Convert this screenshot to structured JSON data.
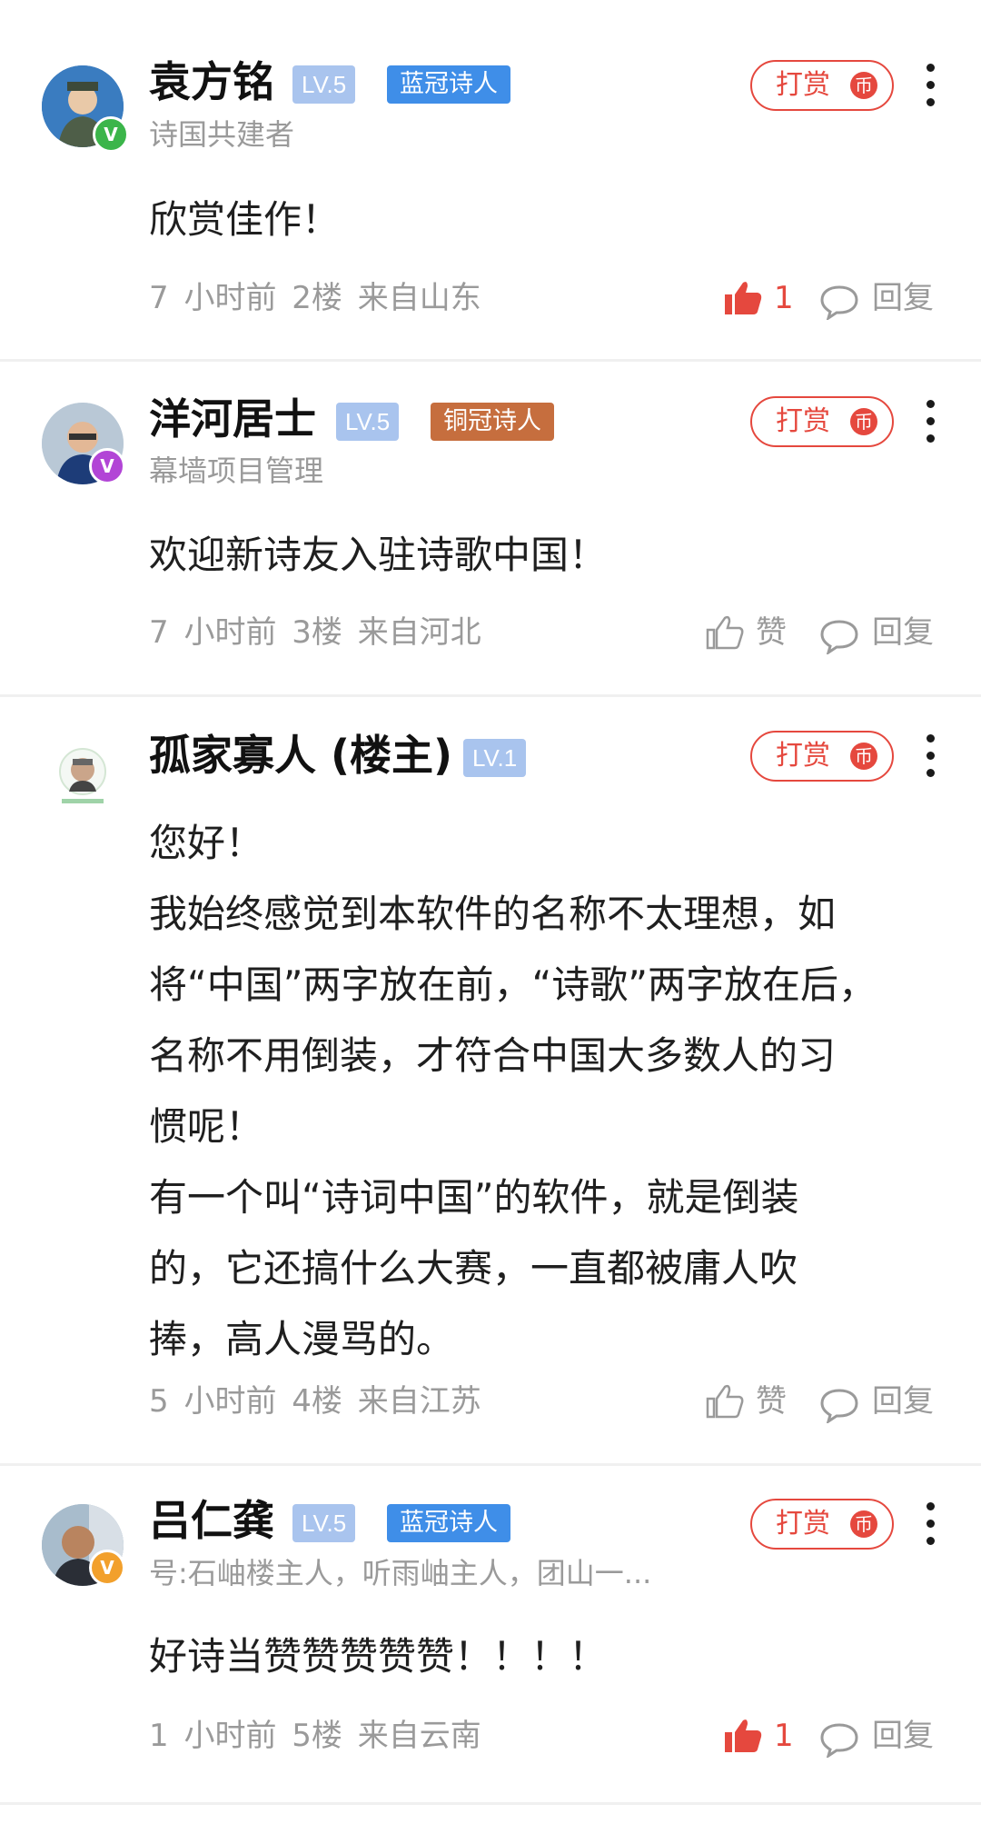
{
  "comments": [
    {
      "name": "袁方铭",
      "level": "LV.5",
      "badge": "蓝冠诗人",
      "badge_color": "#3f8ee8",
      "subtitle": "诗国共建者",
      "body": [
        "欣赏佳作！"
      ],
      "time": "7 小时前",
      "floor": "2楼",
      "location": "来自山东",
      "like_label": "1",
      "liked": true,
      "verified_color": "#3bb54a",
      "tip_label": "打赏",
      "reply_label": "回复"
    },
    {
      "name": "洋河居士",
      "level": "LV.5",
      "badge": "铜冠诗人",
      "badge_color": "#c66e3e",
      "subtitle": "幕墙项目管理",
      "body": [
        "欢迎新诗友入驻诗歌中国！"
      ],
      "time": "7 小时前",
      "floor": "3楼",
      "location": "来自河北",
      "like_label": "赞",
      "liked": false,
      "verified_color": "#b245d6",
      "tip_label": "打赏",
      "reply_label": "回复"
    },
    {
      "name": "孤家寡人 (楼主)",
      "level": "LV.1",
      "subtitle": "",
      "body": [
        "您好！",
        "我始终感觉到本软件的名称不太理想，如",
        "将“中国”两字放在前，“诗歌”两字放在后，",
        "名称不用倒装，才符合中国大多数人的习",
        "惯呢！",
        "有一个叫“诗词中国”的软件，就是倒装",
        "的，它还搞什么大赛，一直都被庸人吹",
        "捧，高人漫骂的。"
      ],
      "time": "5 小时前",
      "floor": "4楼",
      "location": "来自江苏",
      "like_label": "赞",
      "liked": false,
      "tip_label": "打赏",
      "reply_label": "回复"
    },
    {
      "name": "吕仁龚",
      "level": "LV.5",
      "badge": "蓝冠诗人",
      "badge_color": "#3f8ee8",
      "subtitle": "号:石岫楼主人，听雨岫主人，团山一...",
      "body": [
        "好诗当赞赞赞赞赞！！！！"
      ],
      "time": "1 小时前",
      "floor": "5楼",
      "location": "来自云南",
      "like_label": "1",
      "liked": true,
      "verified_color": "#f2a02c",
      "tip_label": "打赏",
      "reply_label": "回复"
    }
  ],
  "colors": {
    "accent_red": "#e5483e",
    "meta_gray": "#9a9a9a",
    "level_blue": "#a9c4ee"
  }
}
